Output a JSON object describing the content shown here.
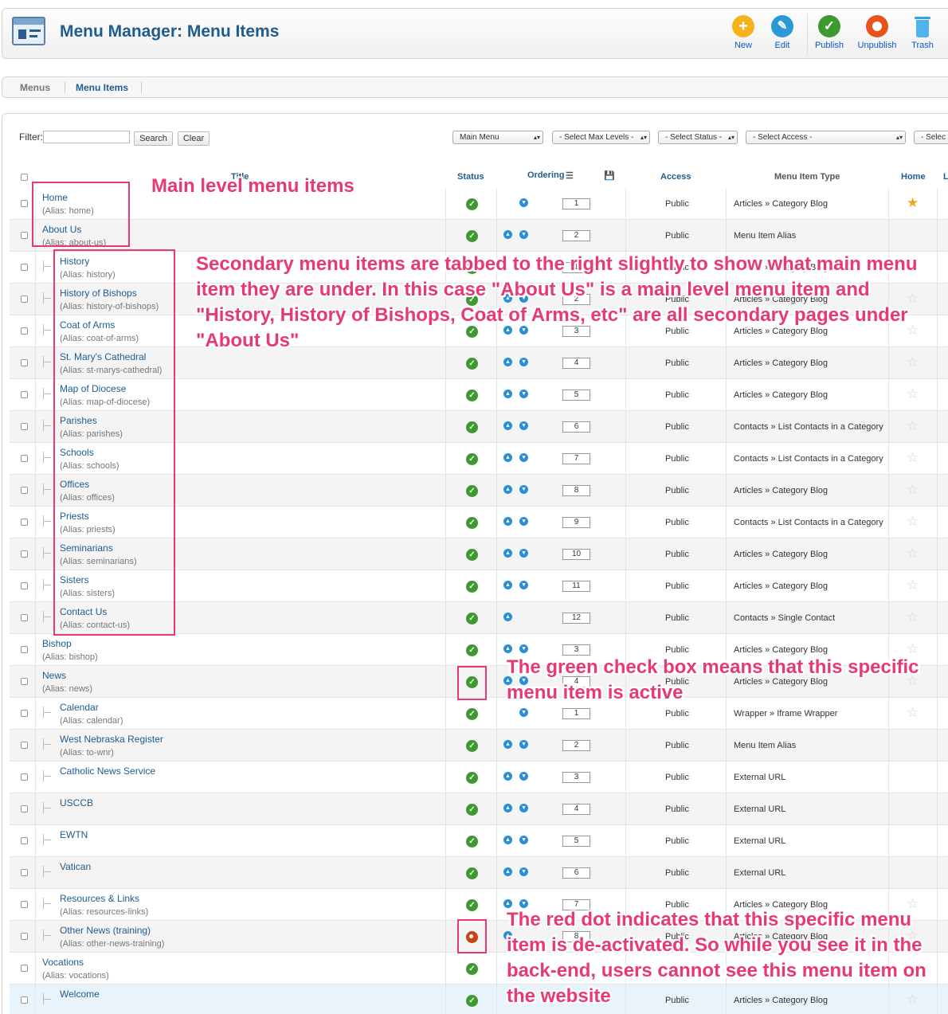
{
  "header": {
    "title": "Menu Manager: Menu Items",
    "toolbar": {
      "new": "New",
      "edit": "Edit",
      "publish": "Publish",
      "unpublish": "Unpublish",
      "trash": "Trash"
    }
  },
  "submenu": {
    "menus": "Menus",
    "menu_items": "Menu Items"
  },
  "filter": {
    "label": "Filter:",
    "value": "",
    "search_label": "Search",
    "clear_label": "Clear",
    "menu_select": "Main Menu",
    "max_levels": "- Select Max Levels -",
    "status": "- Select Status -",
    "access": "- Select Access -",
    "language": "- Selec"
  },
  "columns": {
    "title": "Title",
    "status": "Status",
    "ordering": "Ordering",
    "access": "Access",
    "type": "Menu Item Type",
    "home": "Home",
    "lang": "L"
  },
  "alias_prefix": "(Alias: ",
  "rows": [
    {
      "title": "Home",
      "alias": "home",
      "level": 1,
      "status": "published",
      "up": false,
      "down": true,
      "order": "1",
      "access": "Public",
      "type": "Articles » Category Blog",
      "home": "default"
    },
    {
      "title": "About Us",
      "alias": "about-us",
      "level": 1,
      "status": "published",
      "up": true,
      "down": true,
      "order": "2",
      "access": "Public",
      "type": "Menu Item Alias",
      "home": "none"
    },
    {
      "title": "History",
      "alias": "history",
      "level": 2,
      "status": "published",
      "up": false,
      "down": true,
      "order": "1",
      "access": "Public",
      "type": "Articles » Category Blog",
      "home": "star"
    },
    {
      "title": "History of Bishops",
      "alias": "history-of-bishops",
      "level": 2,
      "status": "published",
      "up": true,
      "down": true,
      "order": "2",
      "access": "Public",
      "type": "Articles » Category Blog",
      "home": "star"
    },
    {
      "title": "Coat of Arms",
      "alias": "coat-of-arms",
      "level": 2,
      "status": "published",
      "up": true,
      "down": true,
      "order": "3",
      "access": "Public",
      "type": "Articles » Category Blog",
      "home": "star"
    },
    {
      "title": "St. Mary's Cathedral",
      "alias": "st-marys-cathedral",
      "level": 2,
      "status": "published",
      "up": true,
      "down": true,
      "order": "4",
      "access": "Public",
      "type": "Articles » Category Blog",
      "home": "star"
    },
    {
      "title": "Map of Diocese",
      "alias": "map-of-diocese",
      "level": 2,
      "status": "published",
      "up": true,
      "down": true,
      "order": "5",
      "access": "Public",
      "type": "Articles » Category Blog",
      "home": "star"
    },
    {
      "title": "Parishes",
      "alias": "parishes",
      "level": 2,
      "status": "published",
      "up": true,
      "down": true,
      "order": "6",
      "access": "Public",
      "type": "Contacts » List Contacts in a Category",
      "home": "star"
    },
    {
      "title": "Schools",
      "alias": "schools",
      "level": 2,
      "status": "published",
      "up": true,
      "down": true,
      "order": "7",
      "access": "Public",
      "type": "Contacts » List Contacts in a Category",
      "home": "star"
    },
    {
      "title": "Offices",
      "alias": "offices",
      "level": 2,
      "status": "published",
      "up": true,
      "down": true,
      "order": "8",
      "access": "Public",
      "type": "Articles » Category Blog",
      "home": "star"
    },
    {
      "title": "Priests",
      "alias": "priests",
      "level": 2,
      "status": "published",
      "up": true,
      "down": true,
      "order": "9",
      "access": "Public",
      "type": "Contacts » List Contacts in a Category",
      "home": "star"
    },
    {
      "title": "Seminarians",
      "alias": "seminarians",
      "level": 2,
      "status": "published",
      "up": true,
      "down": true,
      "order": "10",
      "access": "Public",
      "type": "Articles » Category Blog",
      "home": "star"
    },
    {
      "title": "Sisters",
      "alias": "sisters",
      "level": 2,
      "status": "published",
      "up": true,
      "down": true,
      "order": "11",
      "access": "Public",
      "type": "Articles » Category Blog",
      "home": "star"
    },
    {
      "title": "Contact Us",
      "alias": "contact-us",
      "level": 2,
      "status": "published",
      "up": true,
      "down": false,
      "order": "12",
      "access": "Public",
      "type": "Contacts » Single Contact",
      "home": "star"
    },
    {
      "title": "Bishop",
      "alias": "bishop",
      "level": 1,
      "status": "published",
      "up": true,
      "down": true,
      "order": "3",
      "access": "Public",
      "type": "Articles » Category Blog",
      "home": "star"
    },
    {
      "title": "News",
      "alias": "news",
      "level": 1,
      "status": "published",
      "up": true,
      "down": true,
      "order": "4",
      "access": "Public",
      "type": "Articles » Category Blog",
      "home": "star"
    },
    {
      "title": "Calendar",
      "alias": "calendar",
      "level": 2,
      "status": "published",
      "up": false,
      "down": true,
      "order": "1",
      "access": "Public",
      "type": "Wrapper » Iframe Wrapper",
      "home": "star"
    },
    {
      "title": "West Nebraska Register",
      "alias": "to-wnr",
      "level": 2,
      "status": "published",
      "up": true,
      "down": true,
      "order": "2",
      "access": "Public",
      "type": "Menu Item Alias",
      "home": "none"
    },
    {
      "title": "Catholic News Service",
      "alias": "",
      "level": 2,
      "status": "published",
      "up": true,
      "down": true,
      "order": "3",
      "access": "Public",
      "type": "External URL",
      "home": "none"
    },
    {
      "title": "USCCB",
      "alias": "",
      "level": 2,
      "status": "published",
      "up": true,
      "down": true,
      "order": "4",
      "access": "Public",
      "type": "External URL",
      "home": "none"
    },
    {
      "title": "EWTN",
      "alias": "",
      "level": 2,
      "status": "published",
      "up": true,
      "down": true,
      "order": "5",
      "access": "Public",
      "type": "External URL",
      "home": "none"
    },
    {
      "title": "Vatican",
      "alias": "",
      "level": 2,
      "status": "published",
      "up": true,
      "down": true,
      "order": "6",
      "access": "Public",
      "type": "External URL",
      "home": "none"
    },
    {
      "title": "Resources & Links",
      "alias": "resources-links",
      "level": 2,
      "status": "published",
      "up": true,
      "down": true,
      "order": "7",
      "access": "Public",
      "type": "Articles » Category Blog",
      "home": "star"
    },
    {
      "title": "Other News (training)",
      "alias": "other-news-training",
      "level": 2,
      "status": "unpublished",
      "up": true,
      "down": false,
      "order": "8",
      "access": "Public",
      "type": "Articles » Category Blog",
      "home": "star"
    },
    {
      "title": "Vocations",
      "alias": "vocations",
      "level": 1,
      "status": "published",
      "up": false,
      "down": false,
      "order": "",
      "access": "",
      "type": "",
      "home": "none"
    },
    {
      "title": "Welcome",
      "alias": "",
      "level": 2,
      "status": "published",
      "up": false,
      "down": false,
      "order": "",
      "access": "Public",
      "type": "Articles » Category Blog",
      "home": "star"
    }
  ],
  "annotations": {
    "main_level": "Main level menu items",
    "secondary": "Secondary menu items are tabbed to the right slightly to show what main menu item they are under. In this case \"About Us\" is a main level menu item and \"History, History of Bishops, Coat of Arms, etc\" are all secondary pages under \"About Us\"",
    "green_check": "The green check box means that this specific menu item is active",
    "red_dot": "The red dot indicates that this specific menu item is de-activated. So while you see it in the back-end, users cannot see this menu item on the website"
  },
  "colors": {
    "accent": "#1e5c8f",
    "annotation": "#e63a77",
    "published": "#3c9a2e",
    "unpublished": "#c8421a"
  }
}
